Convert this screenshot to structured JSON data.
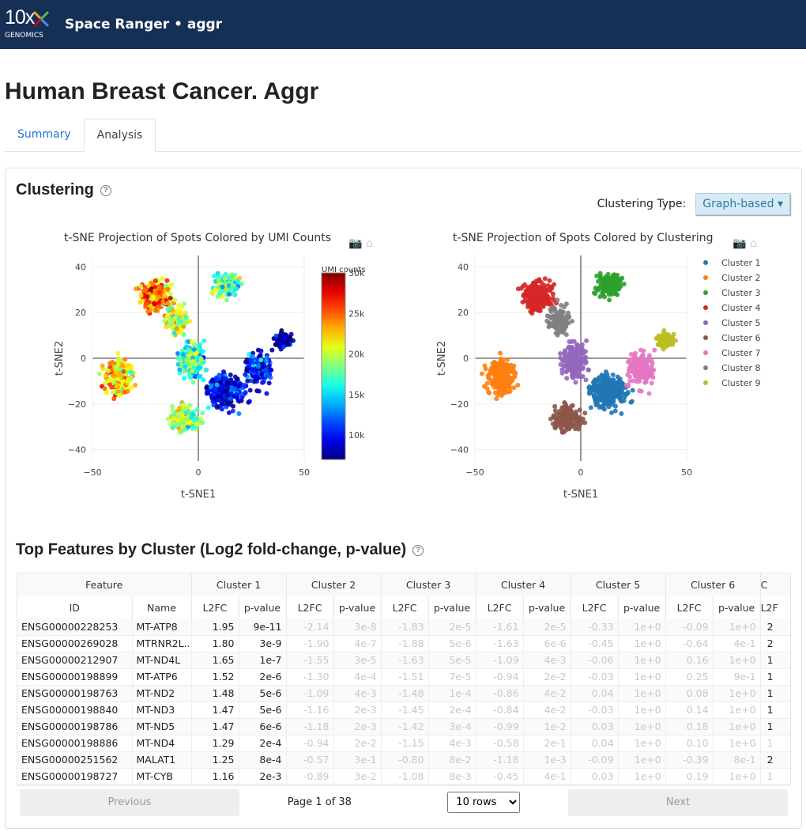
{
  "header": {
    "logo_text": "10x",
    "logo_sub": "GENOMICS",
    "title": "Space Ranger • aggr"
  },
  "page_title": "Human Breast Cancer. Aggr",
  "tabs": [
    {
      "label": "Summary",
      "active": false
    },
    {
      "label": "Analysis",
      "active": true
    }
  ],
  "clustering": {
    "title": "Clustering",
    "help_icon": "question-circle-icon",
    "type_label": "Clustering Type:",
    "type_value": "Graph-based",
    "plot_tools": [
      "camera-icon",
      "home-icon"
    ]
  },
  "chart_data": [
    {
      "type": "scatter",
      "title": "t-SNE Projection of Spots Colored by UMI Counts",
      "xlabel": "t-SNE1",
      "ylabel": "t-SNE2",
      "xlim": [
        -50,
        50
      ],
      "ylim": [
        -45,
        45
      ],
      "xticks": [
        "−50",
        "0",
        "50"
      ],
      "yticks": [
        "40",
        "20",
        "0",
        "−20",
        "−40"
      ],
      "colorbar": {
        "title": "UMI counts",
        "ticks": [
          "30k",
          "25k",
          "20k",
          "15k",
          "10k"
        ],
        "range": [
          7000,
          30000
        ],
        "colorscale": "jet"
      }
    },
    {
      "type": "scatter",
      "title": "t-SNE Projection of Spots Colored by Clustering",
      "xlabel": "t-SNE1",
      "ylabel": "t-SNE2",
      "xlim": [
        -50,
        50
      ],
      "ylim": [
        -45,
        45
      ],
      "xticks": [
        "−50",
        "0",
        "50"
      ],
      "yticks": [
        "40",
        "20",
        "0",
        "−20",
        "−40"
      ],
      "legend": "right",
      "series": [
        {
          "name": "Cluster 1",
          "color": "#1f77b4",
          "center": [
            13,
            -15
          ]
        },
        {
          "name": "Cluster 2",
          "color": "#ff7f0e",
          "center": [
            -38,
            -8
          ]
        },
        {
          "name": "Cluster 3",
          "color": "#2ca02c",
          "center": [
            14,
            32
          ]
        },
        {
          "name": "Cluster 4",
          "color": "#d62728",
          "center": [
            -20,
            27
          ]
        },
        {
          "name": "Cluster 5",
          "color": "#9467bd",
          "center": [
            -3,
            -1
          ]
        },
        {
          "name": "Cluster 6",
          "color": "#8c564b",
          "center": [
            -6,
            -26
          ]
        },
        {
          "name": "Cluster 7",
          "color": "#e377c2",
          "center": [
            28,
            -5
          ]
        },
        {
          "name": "Cluster 8",
          "color": "#7f7f7f",
          "center": [
            -10,
            17
          ]
        },
        {
          "name": "Cluster 9",
          "color": "#bcbd22",
          "center": [
            40,
            8
          ]
        }
      ]
    }
  ],
  "features": {
    "title": "Top Features by Cluster (Log2 fold-change, p-value)",
    "group_headers": [
      "Feature",
      "Cluster 1",
      "Cluster 2",
      "Cluster 3",
      "Cluster 4",
      "Cluster 5",
      "Cluster 6",
      "C"
    ],
    "sub_headers": [
      "ID",
      "Name",
      "L2FC",
      "p-value",
      "L2FC",
      "p-value",
      "L2FC",
      "p-value",
      "L2FC",
      "p-value",
      "L2FC",
      "p-value",
      "L2FC",
      "p-value",
      "L2F"
    ],
    "rows": [
      [
        "ENSG00000228253",
        "MT-ATP8",
        "1.95",
        "9e-11",
        "-2.14",
        "3e-8",
        "-1.83",
        "2e-5",
        "-1.61",
        "2e-5",
        "-0.33",
        "1e+0",
        "-0.09",
        "1e+0",
        "2"
      ],
      [
        "ENSG00000269028",
        "MTRNR2L...",
        "1.80",
        "3e-9",
        "-1.90",
        "4e-7",
        "-1.88",
        "5e-6",
        "-1.63",
        "6e-6",
        "-0.45",
        "1e+0",
        "-0.64",
        "4e-1",
        "2"
      ],
      [
        "ENSG00000212907",
        "MT-ND4L",
        "1.65",
        "1e-7",
        "-1.55",
        "3e-5",
        "-1.63",
        "5e-5",
        "-1.09",
        "4e-3",
        "-0.06",
        "1e+0",
        "0.16",
        "1e+0",
        "1"
      ],
      [
        "ENSG00000198899",
        "MT-ATP6",
        "1.52",
        "2e-6",
        "-1.30",
        "4e-4",
        "-1.51",
        "7e-5",
        "-0.94",
        "2e-2",
        "-0.03",
        "1e+0",
        "0.25",
        "9e-1",
        "1"
      ],
      [
        "ENSG00000198763",
        "MT-ND2",
        "1.48",
        "5e-6",
        "-1.09",
        "4e-3",
        "-1.48",
        "1e-4",
        "-0.86",
        "4e-2",
        "0.04",
        "1e+0",
        "0.08",
        "1e+0",
        "1"
      ],
      [
        "ENSG00000198840",
        "MT-ND3",
        "1.47",
        "5e-6",
        "-1.16",
        "2e-3",
        "-1.45",
        "2e-4",
        "-0.84",
        "4e-2",
        "-0.03",
        "1e+0",
        "0.14",
        "1e+0",
        "1"
      ],
      [
        "ENSG00000198786",
        "MT-ND5",
        "1.47",
        "6e-6",
        "-1.18",
        "2e-3",
        "-1.42",
        "3e-4",
        "-0.99",
        "1e-2",
        "0.03",
        "1e+0",
        "0.18",
        "1e+0",
        "1"
      ],
      [
        "ENSG00000198886",
        "MT-ND4",
        "1.29",
        "2e-4",
        "-0.94",
        "2e-2",
        "-1.15",
        "4e-3",
        "-0.58",
        "2e-1",
        "0.04",
        "1e+0",
        "0.10",
        "1e+0",
        "1"
      ],
      [
        "ENSG00000251562",
        "MALAT1",
        "1.25",
        "8e-4",
        "-0.57",
        "3e-1",
        "-0.80",
        "8e-2",
        "-1.18",
        "1e-3",
        "-0.09",
        "1e+0",
        "-0.39",
        "8e-1",
        "2"
      ],
      [
        "ENSG00000198727",
        "MT-CYB",
        "1.16",
        "2e-3",
        "-0.89",
        "3e-2",
        "-1.08",
        "8e-3",
        "-0.45",
        "4e-1",
        "0.03",
        "1e+0",
        "0.19",
        "1e+0",
        "1"
      ]
    ],
    "pagination": {
      "previous": "Previous",
      "page_info": "Page 1 of 38",
      "rows_option": "10 rows",
      "next": "Next"
    }
  }
}
